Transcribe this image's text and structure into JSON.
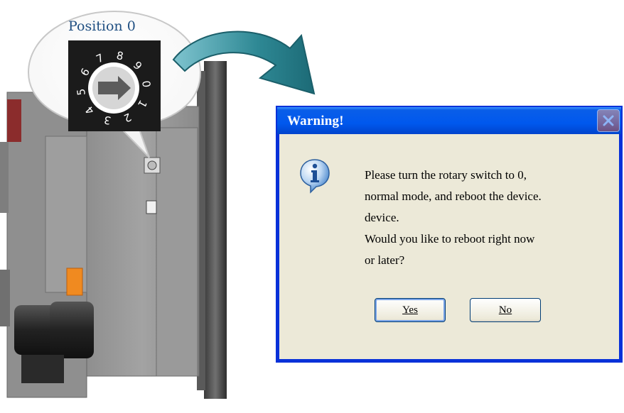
{
  "callout": {
    "title": "Position 0",
    "dial_digits": [
      "7",
      "8",
      "9",
      "0",
      "1",
      "2",
      "3",
      "4",
      "5",
      "6"
    ]
  },
  "dialog": {
    "title": "Warning!",
    "message_lines": [
      "Please turn the rotary switch to 0,",
      "normal mode, and reboot the device.",
      "device.",
      "Would you like to reboot right now",
      "or later?"
    ],
    "yes_label": "Yes",
    "no_label": "No"
  },
  "icons": {
    "dialog": "info-icon",
    "close": "close-icon",
    "arrow": "curved-arrow-icon"
  },
  "colors": {
    "titlebar": "#0058ee",
    "dialog_face": "#ece9d8",
    "arrow": "#2a7f8a",
    "callout_text": "#1f4f82"
  }
}
